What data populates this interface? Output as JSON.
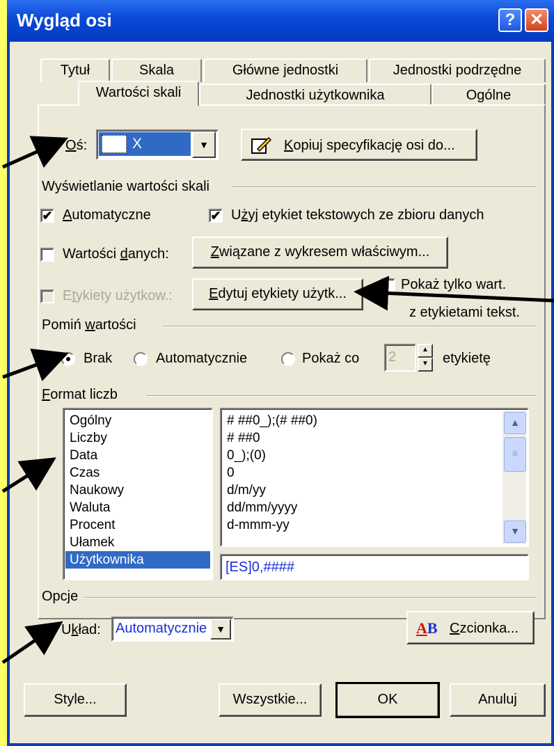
{
  "window": {
    "title": "Wygląd osi",
    "help_glyph": "?",
    "close_glyph": "✕"
  },
  "tabs": {
    "row1": [
      "Tytuł",
      "Skala",
      "Główne jednostki",
      "Jednostki podrzędne"
    ],
    "row2": [
      "Wartości skali",
      "Jednostki użytkownika",
      "Ogólne"
    ],
    "active": "Wartości skali"
  },
  "axis": {
    "label_prefix": "",
    "label_mnemonic": "O",
    "label_rest": "ś:",
    "selected": "X",
    "copy_button": {
      "mnemonic": "K",
      "rest": "opiuj specyfikację osi do..."
    }
  },
  "scale_display": {
    "header": "Wyświetlanie wartości skali",
    "automatic": {
      "mnemonic": "A",
      "rest": "utomatyczne",
      "checked": true
    },
    "use_text_labels": {
      "pre": "U",
      "mnemonic": "ż",
      "rest": "yj etykiet tekstowych ze zbioru danych",
      "checked": true
    },
    "data_values": {
      "pre": "Wartości ",
      "mnemonic": "d",
      "rest": "anych:",
      "checked": false
    },
    "related_button": {
      "mnemonic": "Z",
      "rest": "wiązane z wykresem właściwym..."
    },
    "user_labels": {
      "pre": "E",
      "mnemonic": "t",
      "rest": "ykiety użytkow.:",
      "checked": false,
      "disabled": true
    },
    "edit_labels_button": {
      "mnemonic": "E",
      "rest": "dytuj etykiety użytk..."
    },
    "show_only": {
      "line1": "Pokaż tylko wart.",
      "line2": "z etykietami tekst.",
      "checked": false
    }
  },
  "skip_values": {
    "header_pre": "Pomiń ",
    "header_mnemonic": "w",
    "header_rest": "artości",
    "options": [
      "Brak",
      "Automatycznie",
      "Pokaż co"
    ],
    "selected": "Brak",
    "every_value": "2",
    "suffix": "etykietę"
  },
  "number_format": {
    "header_mnemonic": "F",
    "header_rest": "ormat liczb",
    "categories": [
      "Ogólny",
      "Liczby",
      "Data",
      "Czas",
      "Naukowy",
      "Waluta",
      "Procent",
      "Ułamek",
      "Użytkownika"
    ],
    "selected_category": "Użytkownika",
    "formats": [
      "# ##0_);(# ##0)",
      "# ##0",
      "0_);(0)",
      "0",
      "d/m/yy",
      "dd/mm/yyyy",
      "d-mmm-yy"
    ],
    "custom_value": "[ES]0,####"
  },
  "options": {
    "header": "Opcje",
    "layout_pre": "U",
    "layout_mnemonic": "k",
    "layout_rest": "ład:",
    "layout_value": "Automatycznie",
    "font_icon_text": "AB",
    "font_button": {
      "mnemonic": "C",
      "rest": "zcionka..."
    }
  },
  "footer": {
    "style": "Style...",
    "all": "Wszystkie...",
    "ok": "OK",
    "cancel": "Anuluj"
  },
  "colors": {
    "titlebar": "#0a49d6",
    "background": "#ffff66",
    "selection": "#316ac5",
    "dialog": "#ece9d8"
  }
}
